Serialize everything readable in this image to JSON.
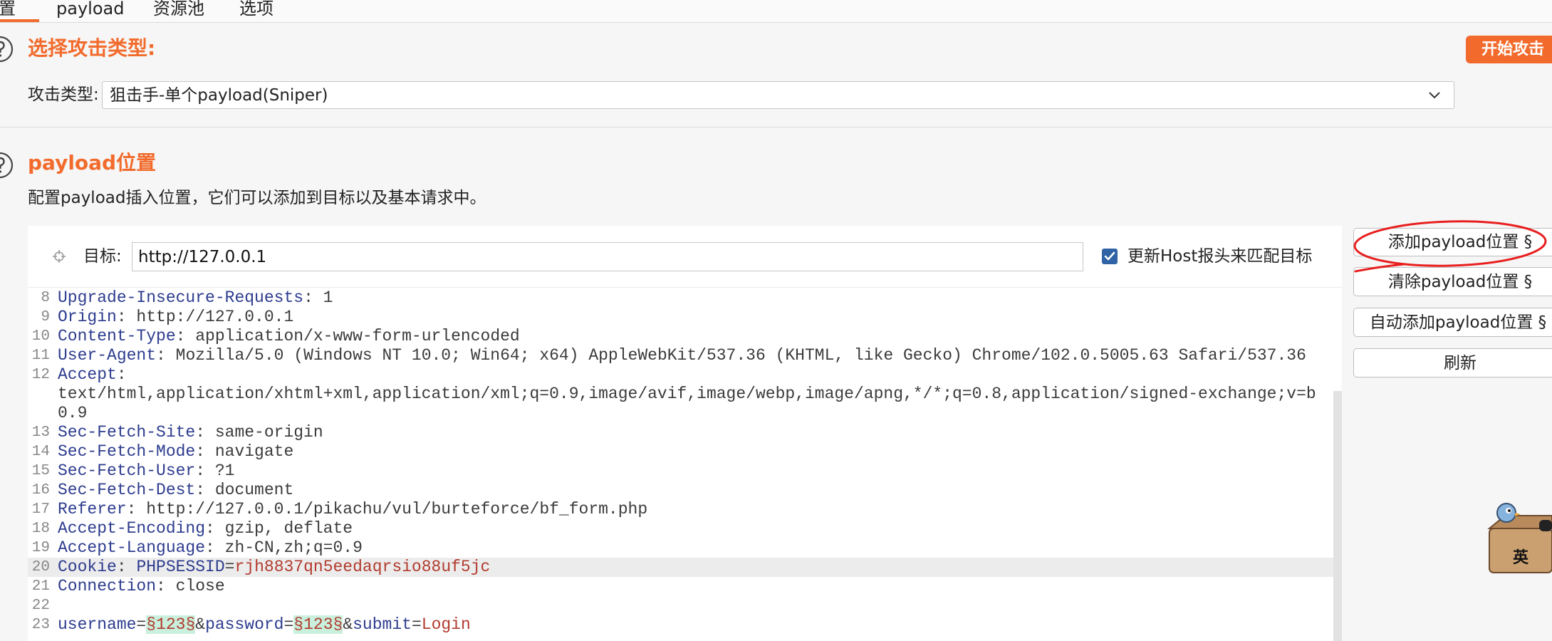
{
  "tabs": [
    {
      "label": "置",
      "active": true
    },
    {
      "label": "payload",
      "active": false
    },
    {
      "label": "资源池",
      "active": false
    },
    {
      "label": "选项",
      "active": false
    }
  ],
  "attack_type": {
    "title": "选择攻击类型:",
    "start_button": "开始攻击",
    "type_label": "攻击类型:",
    "selected_type": "狙击手-单个payload(Sniper)"
  },
  "positions": {
    "title": "payload位置",
    "description": "配置payload插入位置，它们可以添加到目标以及基本请求中。",
    "target_label": "目标:",
    "target_value": "http://127.0.0.1",
    "update_host_label": "更新Host报头来匹配目标",
    "update_host_checked": true
  },
  "request_lines": [
    {
      "n": "8",
      "tokens": [
        {
          "name": "Upgrade-Insecure-Requests"
        },
        {
          "text": ": 1"
        }
      ]
    },
    {
      "n": "9",
      "tokens": [
        {
          "name": "Origin"
        },
        {
          "text": ": http://127.0.0.1"
        }
      ]
    },
    {
      "n": "10",
      "tokens": [
        {
          "name": "Content-Type"
        },
        {
          "text": ": application/x-www-form-urlencoded"
        }
      ]
    },
    {
      "n": "11",
      "tokens": [
        {
          "name": "User-Agent"
        },
        {
          "text": ": Mozilla/5.0 (Windows NT 10.0; Win64; x64) AppleWebKit/537.36 (KHTML, like Gecko) Chrome/102.0.5005.63 Safari/537.36"
        }
      ]
    },
    {
      "n": "12",
      "tokens": [
        {
          "name": "Accept"
        },
        {
          "text": ":"
        }
      ]
    },
    {
      "n": "",
      "tokens": [
        {
          "text": "text/html,application/xhtml+xml,application/xml;q=0.9,image/avif,image/webp,image/apng,*/*;q=0.8,application/signed-exchange;v=b"
        }
      ]
    },
    {
      "n": "",
      "tokens": [
        {
          "text": "0.9"
        }
      ]
    },
    {
      "n": "13",
      "tokens": [
        {
          "name": "Sec-Fetch-Site"
        },
        {
          "text": ": same-origin"
        }
      ]
    },
    {
      "n": "14",
      "tokens": [
        {
          "name": "Sec-Fetch-Mode"
        },
        {
          "text": ": navigate"
        }
      ]
    },
    {
      "n": "15",
      "tokens": [
        {
          "name": "Sec-Fetch-User"
        },
        {
          "text": ": ?1"
        }
      ]
    },
    {
      "n": "16",
      "tokens": [
        {
          "name": "Sec-Fetch-Dest"
        },
        {
          "text": ": document"
        }
      ]
    },
    {
      "n": "17",
      "tokens": [
        {
          "name": "Referer"
        },
        {
          "text": ": http://127.0.0.1/pikachu/vul/burteforce/bf_form.php"
        }
      ]
    },
    {
      "n": "18",
      "tokens": [
        {
          "name": "Accept-Encoding"
        },
        {
          "text": ": gzip, deflate"
        }
      ]
    },
    {
      "n": "19",
      "tokens": [
        {
          "name": "Accept-Language"
        },
        {
          "text": ": zh-CN,zh;q=0.9"
        }
      ]
    },
    {
      "n": "20",
      "current": true,
      "tokens": [
        {
          "name": "Cookie"
        },
        {
          "text": ": "
        },
        {
          "name": "PHPSESSID"
        },
        {
          "text": "="
        },
        {
          "value": "rjh8837qn5eedaqrsio88uf5jc"
        }
      ]
    },
    {
      "n": "21",
      "tokens": [
        {
          "name": "Connection"
        },
        {
          "text": ": close"
        }
      ]
    },
    {
      "n": "22",
      "tokens": []
    },
    {
      "n": "23",
      "tokens": [
        {
          "name": "username"
        },
        {
          "text": "="
        },
        {
          "marker": "§123§"
        },
        {
          "text": "&"
        },
        {
          "name": "password"
        },
        {
          "text": "="
        },
        {
          "marker": "§123§"
        },
        {
          "text": "&"
        },
        {
          "name": "submit"
        },
        {
          "text": "="
        },
        {
          "value": "Login"
        }
      ]
    }
  ],
  "side_buttons": {
    "add": "添加payload位置 §",
    "clear": "清除payload位置 §",
    "auto": "自动添加payload位置 §",
    "refresh": "刷新"
  },
  "ime": {
    "mode": "英"
  },
  "icons": {
    "section_help": "help-icon",
    "target": "crosshair-icon",
    "select": "chevron-down-icon",
    "checkbox": "checkmark-icon",
    "ime": "ime-mascot-icon"
  },
  "colors": {
    "accent": "#f26b2c",
    "header_name": "#2d3c8e",
    "value_red": "#b23b2e",
    "marker_bg": "#c9efdd",
    "checkbox": "#2f63a6",
    "annotation": "#e81e1e"
  }
}
